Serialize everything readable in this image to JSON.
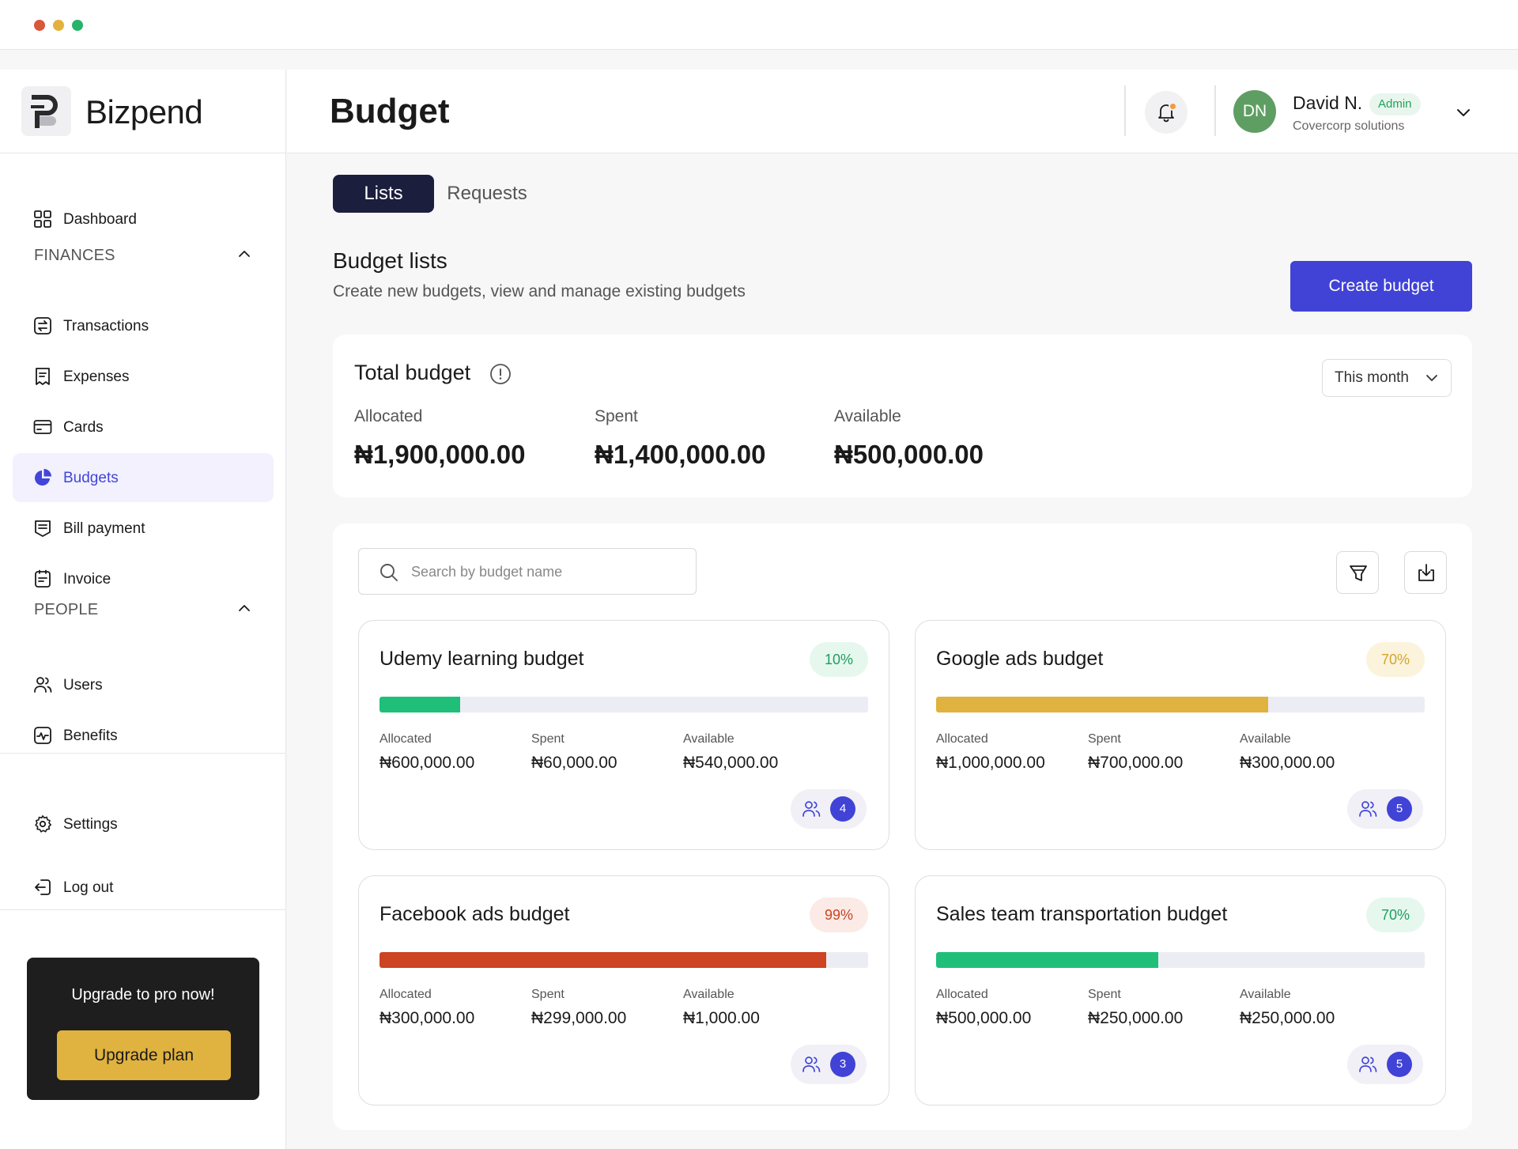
{
  "window": {
    "controls": [
      "close",
      "minimize",
      "maximize"
    ],
    "control_colors": [
      "#d9573b",
      "#e4b13f",
      "#27b36a"
    ]
  },
  "brand": {
    "name": "Bizpend",
    "logo_icon": "bizpend-logo-icon"
  },
  "sidebar": {
    "dashboard": {
      "label": "Dashboard",
      "icon": "grid-icon"
    },
    "finances": {
      "heading": "FINANCES",
      "items": [
        {
          "label": "Transactions",
          "icon": "transactions-icon"
        },
        {
          "label": "Expenses",
          "icon": "receipt-icon"
        },
        {
          "label": "Cards",
          "icon": "card-icon"
        },
        {
          "label": "Budgets",
          "icon": "pie-chart-icon",
          "active": true
        },
        {
          "label": "Bill payment",
          "icon": "bill-icon"
        },
        {
          "label": "Invoice",
          "icon": "invoice-icon"
        }
      ]
    },
    "people": {
      "heading": "PEOPLE",
      "items": [
        {
          "label": "Users",
          "icon": "users-icon"
        },
        {
          "label": "Benefits",
          "icon": "benefits-icon"
        }
      ]
    },
    "settings": {
      "label": "Settings",
      "icon": "gear-icon"
    },
    "logout": {
      "label": "Log out",
      "icon": "logout-icon"
    },
    "upgrade": {
      "title": "Upgrade to pro  now!",
      "button": "Upgrade plan"
    }
  },
  "header": {
    "title": "Budget",
    "notification_icon": "bell-icon",
    "user": {
      "initials": "DN",
      "name": "David N.",
      "role": "Admin",
      "org": "Covercorp solutions"
    }
  },
  "tabs": [
    {
      "label": "Lists",
      "active": true
    },
    {
      "label": "Requests",
      "active": false
    }
  ],
  "budget_lists": {
    "title": "Budget lists",
    "subtitle": "Create new budgets, view and manage existing budgets",
    "create_button": "Create budget"
  },
  "total_budget": {
    "title": "Total budget",
    "period": "This month",
    "allocated_label": "Allocated",
    "allocated": "₦1,900,000.00",
    "spent_label": "Spent",
    "spent": "₦1,400,000.00",
    "available_label": "Available",
    "available": "₦500,000.00"
  },
  "toolbar": {
    "search_placeholder": "Search by budget name",
    "search_value": "",
    "filter_icon": "filter-icon",
    "download_icon": "download-icon"
  },
  "colors": {
    "accent": "#4043d6",
    "dark": "#1b1e3d",
    "green": "#1fbf7a",
    "yellow": "#e0b23f",
    "red": "#cc4422"
  },
  "budgets": [
    {
      "name": "Udemy learning budget",
      "percent_label": "10%",
      "progress": 0.165,
      "bar_color": "#1fbf7a",
      "badge_bg": "#e6f7ee",
      "badge_fg": "#1f9e5e",
      "allocated_label": "Allocated",
      "allocated": "₦600,000.00",
      "spent_label": "Spent",
      "spent": "₦60,000.00",
      "available_label": "Available",
      "available": "₦540,000.00",
      "members": "4"
    },
    {
      "name": "Google ads budget",
      "percent_label": "70%",
      "progress": 0.68,
      "bar_color": "#e0b23f",
      "badge_bg": "#fbf3dc",
      "badge_fg": "#d5a52c",
      "allocated_label": "Allocated",
      "allocated": "₦1,000,000.00",
      "spent_label": "Spent",
      "spent": "₦700,000.00",
      "available_label": "Available",
      "available": "₦300,000.00",
      "members": "5"
    },
    {
      "name": "Facebook ads budget",
      "percent_label": "99%",
      "progress": 0.915,
      "bar_color": "#cc4422",
      "badge_bg": "#fbeae6",
      "badge_fg": "#cc4422",
      "allocated_label": "Allocated",
      "allocated": "₦300,000.00",
      "spent_label": "Spent",
      "spent": "₦299,000.00",
      "available_label": "Available",
      "available": "₦1,000.00",
      "members": "3"
    },
    {
      "name": "Sales team transportation budget",
      "percent_label": "70%",
      "progress": 0.455,
      "bar_color": "#1fbf7a",
      "badge_bg": "#e6f7ee",
      "badge_fg": "#1f9e5e",
      "allocated_label": "Allocated",
      "allocated": "₦500,000.00",
      "spent_label": "Spent",
      "spent": "₦250,000.00",
      "available_label": "Available",
      "available": "₦250,000.00",
      "members": "5"
    }
  ]
}
